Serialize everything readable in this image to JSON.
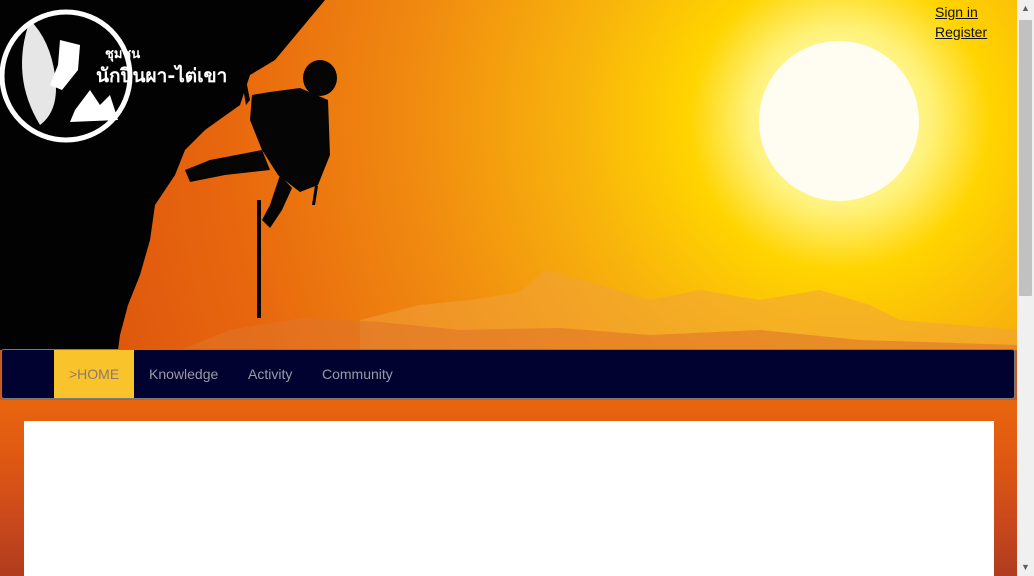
{
  "header": {
    "logo_text_line1": "ชุมชน",
    "logo_text_line2": "นักปีนผา-ไต่เขา"
  },
  "auth": {
    "sign_in": "Sign in",
    "register": "Register"
  },
  "nav": {
    "items": [
      {
        "label": ">HOME",
        "active": true
      },
      {
        "label": "Knowledge",
        "active": false
      },
      {
        "label": "Activity",
        "active": false
      },
      {
        "label": "Community",
        "active": false
      }
    ]
  },
  "colors": {
    "nav_bg": "#020230",
    "nav_active": "#f9c42b",
    "sun": "#fffbe0"
  },
  "icons": {
    "scroll_up": "arrow-up-icon",
    "scroll_down": "arrow-down-icon"
  }
}
